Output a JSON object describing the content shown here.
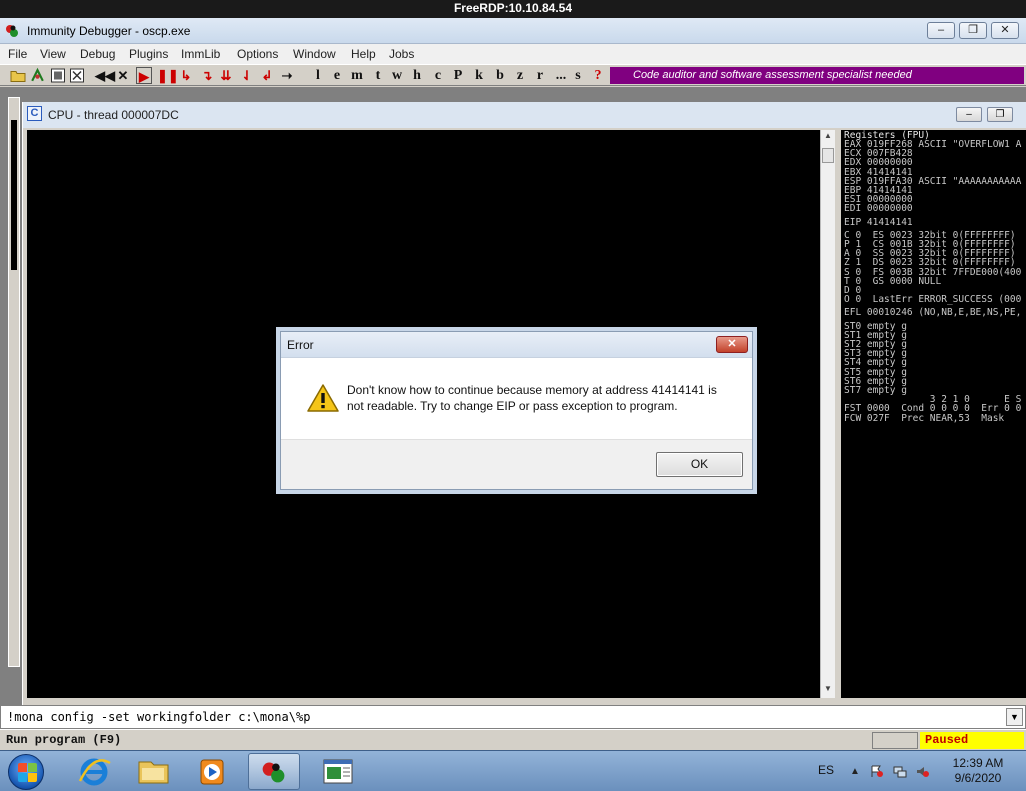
{
  "rdp_title": "FreeRDP:10.10.84.54",
  "window": {
    "title": "Immunity Debugger - oscp.exe",
    "minimize": "‒",
    "restore": "❐",
    "close": "✕"
  },
  "menu": [
    "File",
    "View",
    "Debug",
    "Plugins",
    "ImmLib",
    "Options",
    "Window",
    "Help",
    "Jobs"
  ],
  "toolbar": {
    "letters": [
      "l",
      "e",
      "m",
      "t",
      "w",
      "h",
      "c",
      "P",
      "k",
      "b",
      "z",
      "r",
      "...",
      "s",
      "?"
    ],
    "promo": "Code auditor and software assessment specialist needed"
  },
  "cpu_window": {
    "title": "CPU - thread 000007DC",
    "icon_letter": "C"
  },
  "registers": {
    "header": "Registers (FPU)",
    "lines": [
      "EAX 019FF268 ASCII \"OVERFLOW1 A",
      "ECX 007FB428",
      "EDX 00000000",
      "EBX 41414141",
      "ESP 019FFA30 ASCII \"AAAAAAAAAAA",
      "EBP 41414141",
      "ESI 00000000",
      "EDI 00000000",
      "",
      "EIP 41414141",
      "",
      "C 0  ES 0023 32bit 0(FFFFFFFF)",
      "P 1  CS 001B 32bit 0(FFFFFFFF)",
      "A 0  SS 0023 32bit 0(FFFFFFFF)",
      "Z 1  DS 0023 32bit 0(FFFFFFFF)",
      "S 0  FS 003B 32bit 7FFDE000(400",
      "T 0  GS 0000 NULL",
      "D 0",
      "O 0  LastErr ERROR_SUCCESS (000",
      "",
      "EFL 00010246 (NO,NB,E,BE,NS,PE,",
      "",
      "ST0 empty g",
      "ST1 empty g",
      "ST2 empty g",
      "ST3 empty g",
      "ST4 empty g",
      "ST5 empty g",
      "ST6 empty g",
      "ST7 empty g",
      "               3 2 1 0      E S",
      "FST 0000  Cond 0 0 0 0  Err 0 0",
      "FCW 027F  Prec NEAR,53  Mask"
    ]
  },
  "dialog": {
    "title": "Error",
    "close": "✕",
    "message": "Don't know how to continue because memory at address 41414141 is not readable. Try to change EIP or pass exception to program.",
    "ok": "OK"
  },
  "command": {
    "value": "!mona config -set workingfolder c:\\mona\\%p"
  },
  "status": {
    "text": "Run program (F9)",
    "state": "Paused"
  },
  "taskbar": {
    "lang": "ES",
    "time": "12:39 AM",
    "date": "9/6/2020"
  }
}
